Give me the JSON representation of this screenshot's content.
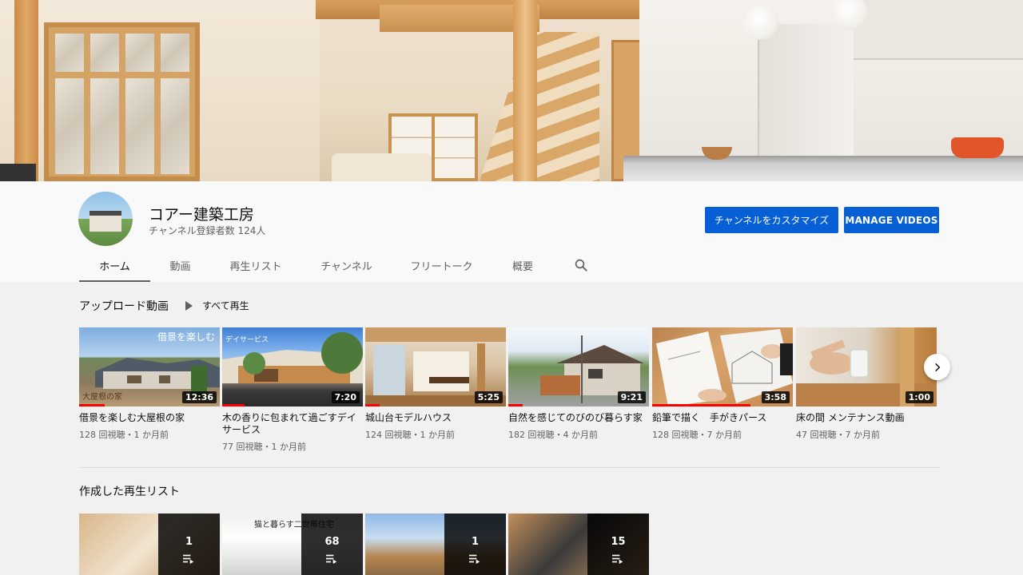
{
  "channel": {
    "name": "コアー建築工房",
    "subscribers": "チャンネル登録者数 124人"
  },
  "buttons": {
    "customize": "チャンネルをカスタマイズ",
    "manage": "MANAGE VIDEOS"
  },
  "tabs": [
    "ホーム",
    "動画",
    "再生リスト",
    "チャンネル",
    "フリートーク",
    "概要"
  ],
  "uploads": {
    "title": "アップロード動画",
    "play_all": "すべて再生",
    "videos": [
      {
        "title": "借景を楽しむ大屋根の家",
        "meta": "128 回視聴・1 か月前",
        "duration": "12:36",
        "overlay_top": "借景を楽しむ",
        "overlay_bottom": "大屋根の家",
        "progress": 0.18
      },
      {
        "title": "木の香りに包まれて過ごすデイサービス",
        "meta": "77 回視聴・1 か月前",
        "duration": "7:20",
        "overlay_top": "デイサービス",
        "overlay_bottom": "",
        "progress": 0.16
      },
      {
        "title": "城山台モデルハウス",
        "meta": "124 回視聴・1 か月前",
        "duration": "5:25",
        "overlay_top": "",
        "overlay_bottom": "",
        "progress": 0.1
      },
      {
        "title": "自然を感じてのびのび暮らす家",
        "meta": "182 回視聴・4 か月前",
        "duration": "9:21",
        "overlay_top": "",
        "overlay_bottom": "",
        "progress": 0.1
      },
      {
        "title": "鉛筆で描く　手がきパース",
        "meta": "128 回視聴・7 か月前",
        "duration": "3:58",
        "overlay_top": "",
        "overlay_bottom": "",
        "progress": 0.7
      },
      {
        "title": "床の間 メンテナンス動画",
        "meta": "47 回視聴・7 か月前",
        "duration": "1:00",
        "overlay_top": "",
        "overlay_bottom": "",
        "progress": 0
      }
    ]
  },
  "playlists": {
    "title": "作成した再生リスト",
    "items": [
      {
        "count": "1"
      },
      {
        "count": "68",
        "overlay_top": "猫と暮らす二世帯住宅"
      },
      {
        "count": "1"
      },
      {
        "count": "15"
      }
    ]
  },
  "colors": {
    "accent": "#065fd4",
    "progress": "#ff0000",
    "text_secondary": "#606060"
  },
  "icons": {
    "search": "search-icon",
    "next": "chevron-right-icon",
    "playlist": "playlist-icon",
    "play": "play-icon"
  }
}
